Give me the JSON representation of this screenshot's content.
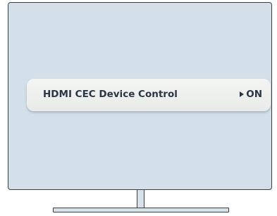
{
  "setting": {
    "label": "HDMI CEC Device Control",
    "value": "ON",
    "arrow_icon": "right-triangle-icon"
  },
  "colors": {
    "screen": "#d3e0e9",
    "row": "#f0f2f0",
    "text": "#2a3646",
    "frame": "#3a3f47"
  }
}
